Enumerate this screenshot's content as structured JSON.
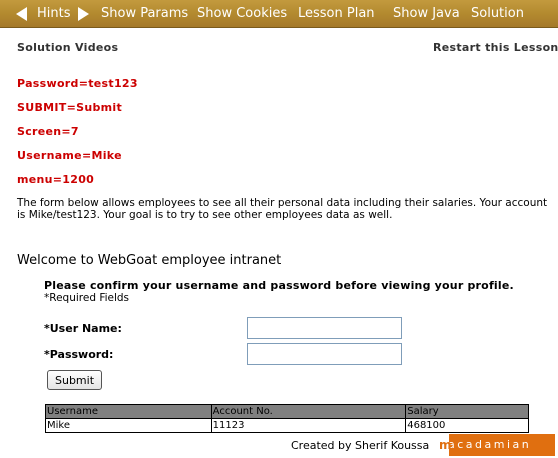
{
  "nav": {
    "hints": "Hints",
    "show_params": "Show Params",
    "show_cookies": "Show Cookies",
    "lesson_plan": "Lesson Plan",
    "show_java": "Show Java",
    "solution": "Solution"
  },
  "links": {
    "solution_videos": "Solution Videos",
    "restart_lesson": "Restart this Lesson"
  },
  "params": [
    "Password=test123",
    "SUBMIT=Submit",
    "Screen=7",
    "Username=Mike",
    "menu=1200"
  ],
  "description": "The form below allows employees to see all their personal data including their salaries. Your account is Mike/test123. Your goal is to try to see other employees data as well.",
  "welcome": "Welcome to WebGoat employee intranet",
  "form": {
    "confirm": "Please confirm your username and password before viewing your profile.",
    "required": "*Required Fields",
    "username_label": "*User Name:",
    "password_label": "*Password:",
    "username_value": "",
    "password_value": "",
    "submit_label": "Submit"
  },
  "table": {
    "headers": [
      "Username",
      "Account No.",
      "Salary"
    ],
    "rows": [
      [
        "Mike",
        "11123",
        "468100"
      ]
    ]
  },
  "footer": {
    "created_by": "Created by Sherif Koussa",
    "logo_m": "m",
    "logo_text": "acadamian"
  },
  "colors": {
    "nav_bar": "#b38a2f",
    "params": "#cc0000",
    "table_header": "#808080",
    "logo": "#e06f10"
  },
  "icons": {
    "prev": "triangle-left",
    "next": "triangle-right"
  }
}
